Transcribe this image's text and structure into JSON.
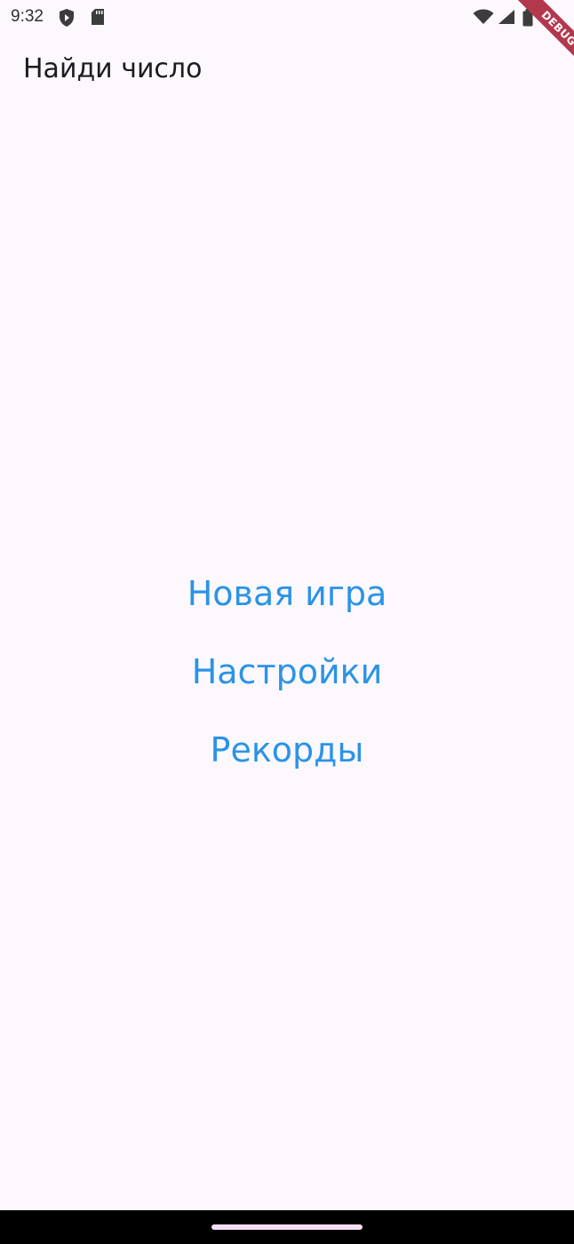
{
  "status_bar": {
    "time": "9:32",
    "left_icons": [
      "shield-icon",
      "sd-card-icon"
    ],
    "right_icons": [
      "wifi-icon",
      "signal-icon",
      "battery-icon"
    ]
  },
  "debug_banner": {
    "label": "DEBUG"
  },
  "app_bar": {
    "title": "Найди число"
  },
  "menu": {
    "new_game": "Новая игра",
    "settings": "Настройки",
    "records": "Рекорды"
  },
  "colors": {
    "background": "#fcf8fd",
    "accent": "#2b93e6",
    "debug_banner": "#b3384d"
  }
}
